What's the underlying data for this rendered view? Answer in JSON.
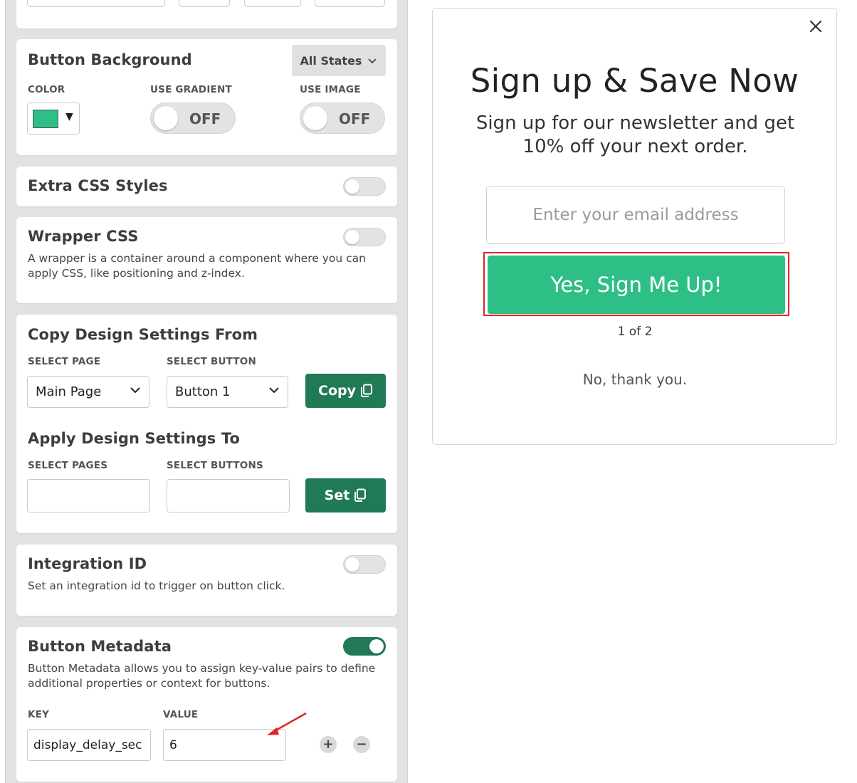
{
  "button_background": {
    "title": "Button Background",
    "states_dropdown": "All States",
    "color_label": "COLOR",
    "color_value": "#2ebf86",
    "gradient_label": "USE GRADIENT",
    "gradient_toggle": "OFF",
    "image_label": "USE IMAGE",
    "image_toggle": "OFF"
  },
  "extra_css": {
    "title": "Extra CSS Styles",
    "enabled": false
  },
  "wrapper_css": {
    "title": "Wrapper CSS",
    "description": "A wrapper is a container around a component where you can apply CSS, like positioning and z-index.",
    "enabled": false
  },
  "copy_design": {
    "title": "Copy Design Settings From",
    "page_label": "SELECT PAGE",
    "page_value": "Main Page",
    "button_label": "SELECT BUTTON",
    "button_value": "Button 1",
    "copy_button": "Copy"
  },
  "apply_design": {
    "title": "Apply Design Settings To",
    "pages_label": "SELECT PAGES",
    "buttons_label": "SELECT BUTTONS",
    "set_button": "Set"
  },
  "integration_id": {
    "title": "Integration ID",
    "description": "Set an integration id to trigger on button click.",
    "enabled": false
  },
  "button_metadata": {
    "title": "Button Metadata",
    "description": "Button Metadata allows you to assign key-value pairs to define additional properties or context for buttons.",
    "enabled": true,
    "key_label": "KEY",
    "value_label": "VALUE",
    "key_value": "display_delay_sec",
    "value_value": "6",
    "add_symbol": "+",
    "remove_symbol": "−"
  },
  "popup": {
    "title": "Sign up & Save Now",
    "subtitle": "Sign up for our newsletter and get 10% off your next order.",
    "email_placeholder": "Enter your email address",
    "signup_button": "Yes, Sign Me Up!",
    "pager": "1 of 2",
    "decline": "No, thank you.",
    "accent_color": "#2ebf86"
  },
  "colors": {
    "primary_green": "#1f7a55",
    "highlight_red": "#e02424"
  }
}
